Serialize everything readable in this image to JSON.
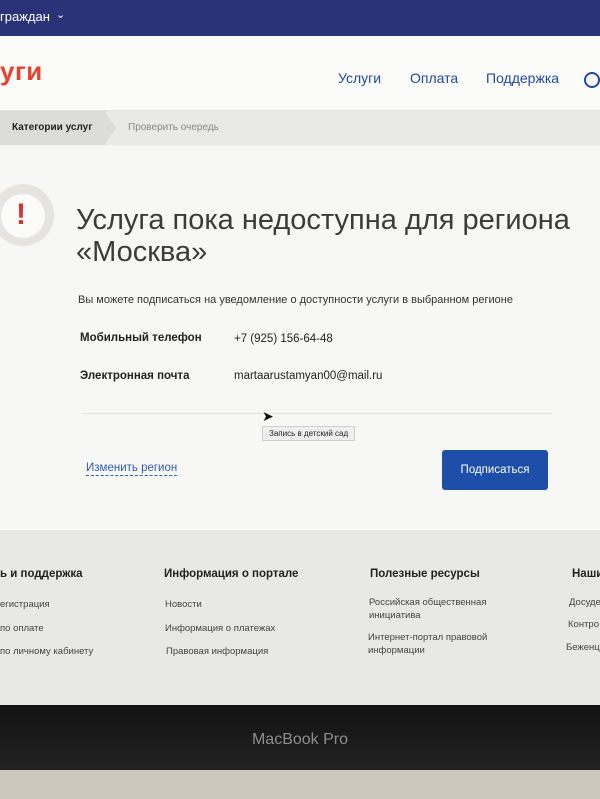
{
  "topbar": {
    "user_label": "граждан"
  },
  "header": {
    "logo_text": "уги",
    "nav": [
      "Услуги",
      "Оплата",
      "Поддержка"
    ]
  },
  "breadcrumb": {
    "active": "Категории услуг",
    "next": "Проверить очередь"
  },
  "card": {
    "title_line1": "Услуга пока недоступна для региона",
    "title_line2": "«Москва»",
    "description": "Вы можете подписаться на уведомление о доступности услуги в выбранном регионе",
    "phone_label": "Мобильный телефон",
    "phone_value": "+7 (925) 156-64-48",
    "email_label": "Электронная почта",
    "email_value": "martaarustamyan00@mail.ru",
    "tooltip": "Запись в детский сад",
    "change_region": "Изменить регион",
    "subscribe": "Подписаться"
  },
  "footer": {
    "col1_title": "ь и поддержка",
    "col1_items": [
      "егистрация",
      "по оплате",
      "по личному кабинету"
    ],
    "col2_title": "Информация о портале",
    "col2_items": [
      "Новости",
      "Информация о платежах",
      "Правовая информация"
    ],
    "col3_title": "Полезные ресурсы",
    "col3_items": [
      "Российская общественная инициатива",
      "Интернет-портал правовой информации"
    ],
    "col4_title": "Наши",
    "col4_items": [
      "Досуде",
      "Контро",
      "Беженц"
    ]
  },
  "bezel": {
    "brand": "MacBook Pro"
  },
  "colors": {
    "accent": "#1d4fa8",
    "alert": "#d6332a",
    "logo": "#e8412c",
    "topbar": "#2a3278"
  }
}
